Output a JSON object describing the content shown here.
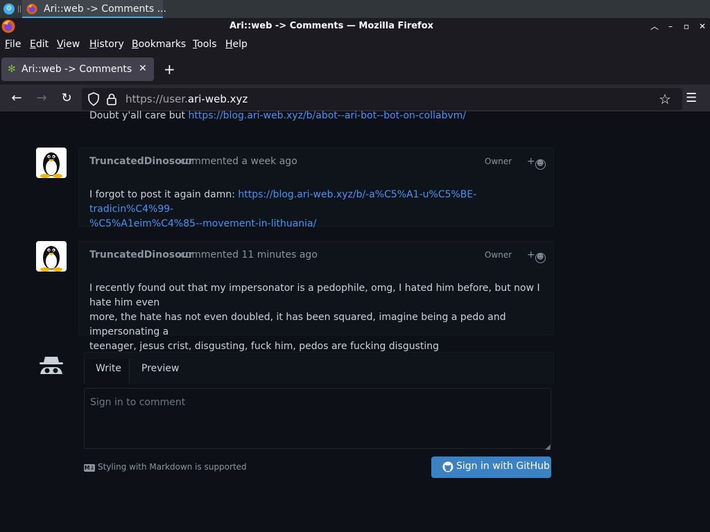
{
  "taskbar": {
    "window_title": "Ari::web -> Comments ..."
  },
  "titlebar": {
    "title": "Ari::web -> Comments — Mozilla Firefox"
  },
  "menubar": {
    "items": [
      "File",
      "Edit",
      "View",
      "History",
      "Bookmarks",
      "Tools",
      "Help"
    ],
    "accelerators": [
      "F",
      "E",
      "V",
      "H",
      "B",
      "T",
      "H"
    ]
  },
  "tabs": [
    {
      "label": "Ari::web -> Comments",
      "active": true
    }
  ],
  "nav": {
    "url_prefix": "https://user.",
    "url_domain": "ari-web.xyz"
  },
  "comments": [
    {
      "body_prefix": "Doubt y'all care but ",
      "link": "https://blog.ari-web.xyz/b/abot--ari-bot--bot-on-collabvm/"
    },
    {
      "author": "TruncatedDinosour",
      "verb": "commented",
      "time": "a week ago",
      "badge": "Owner",
      "body_prefix": "I forgot to post it again damn: ",
      "link_line1": "https://blog.ari-web.xyz/b/-a%C5%A1-u%C5%BE-tradicin%C4%99-",
      "link_line2": "%C5%A1eim%C4%85--movement-in-lithuania/"
    },
    {
      "author": "TruncatedDinosour",
      "verb": "commented",
      "time": "11 minutes ago",
      "badge": "Owner",
      "body_lines": [
        "I recently found out that my impersonator is a pedophile, omg, I hated him before, but now I hate him even",
        "more, the hate has not even doubled, it has been squared, imagine being a pedo and impersonating a",
        "teenager, jesus crist, disgusting, fuck him, pedos are fucking disgusting"
      ]
    }
  ],
  "editor": {
    "tabs": [
      "Write",
      "Preview"
    ],
    "placeholder": "Sign in to comment",
    "markdown_note": "Styling with Markdown is supported",
    "markdown_icon": "M↓",
    "signin_label": "Sign in with GitHub"
  },
  "colors": {
    "link": "#4493f8",
    "signin_button": "#3b82c4",
    "page_bg": "#0d1117"
  }
}
